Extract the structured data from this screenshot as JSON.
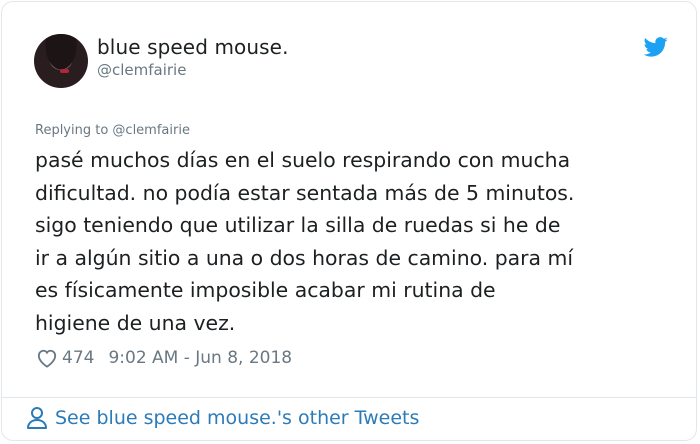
{
  "tweet": {
    "display_name": "blue speed mouse.",
    "handle": "@clemfairie",
    "replying_to": "Replying to @clemfairie",
    "text": "pasé muchos días en el suelo respirando con mucha\ndificultad. no podía estar sentada más de 5 minutos.\nsigo teniendo que utilizar la silla de ruedas si he de\nir a algún sitio a una o dos horas de camino. para mí\nes físicamente imposible acabar mi rutina de\nhigiene de una vez.",
    "likes": "474",
    "timestamp": "9:02 AM - Jun 8, 2018"
  },
  "footer": {
    "link_text": "See blue speed mouse.'s other Tweets"
  },
  "icons": {
    "brand": "twitter-bird-icon",
    "like": "heart-icon",
    "profile": "person-icon"
  },
  "colors": {
    "twitter_blue": "#1da1f2",
    "link_blue": "#2b7bb9",
    "meta_gray": "#697882",
    "text_dark": "#1c2022"
  }
}
